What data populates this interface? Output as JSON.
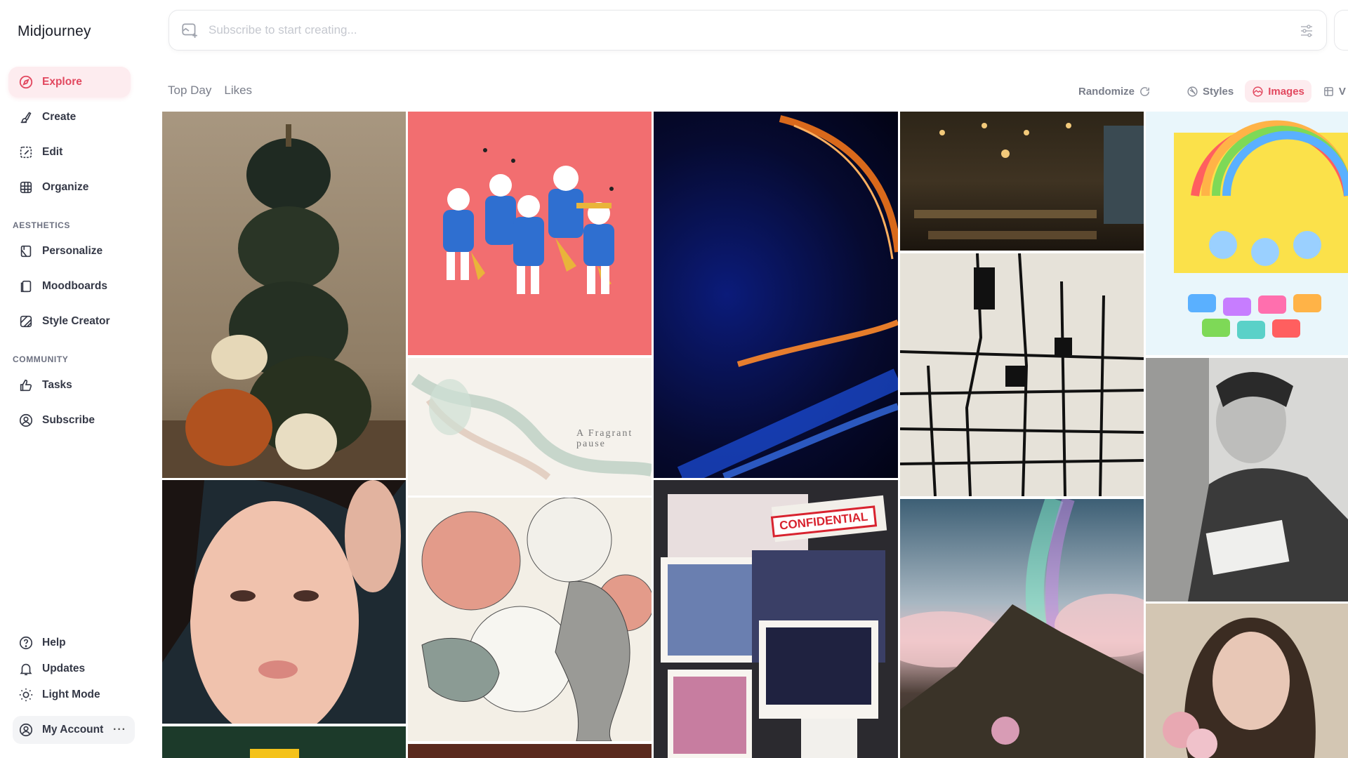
{
  "app": {
    "title": "Midjourney"
  },
  "nav": {
    "explore": "Explore",
    "create": "Create",
    "edit": "Edit",
    "organize": "Organize",
    "aesthetics_label": "AESTHETICS",
    "personalize": "Personalize",
    "moodboards": "Moodboards",
    "style_creator": "Style Creator",
    "community_label": "COMMUNITY",
    "tasks": "Tasks",
    "subscribe": "Subscribe"
  },
  "bottom": {
    "help": "Help",
    "updates": "Updates",
    "light_mode": "Light Mode",
    "account": "My Account",
    "account_more": "···"
  },
  "search": {
    "placeholder": "Subscribe to start creating..."
  },
  "tabs": {
    "top_day": "Top Day",
    "likes": "Likes"
  },
  "toolbar": {
    "randomize": "Randomize",
    "styles": "Styles",
    "images": "Images",
    "videos_partial": "V"
  },
  "gallery": {
    "text_art": {
      "line1": "A Fragrant",
      "line2": "pause"
    },
    "stamp_text": "CONFIDENTIAL"
  },
  "colors": {
    "accent": "#e2485f",
    "accent_bg": "#fdecef"
  }
}
